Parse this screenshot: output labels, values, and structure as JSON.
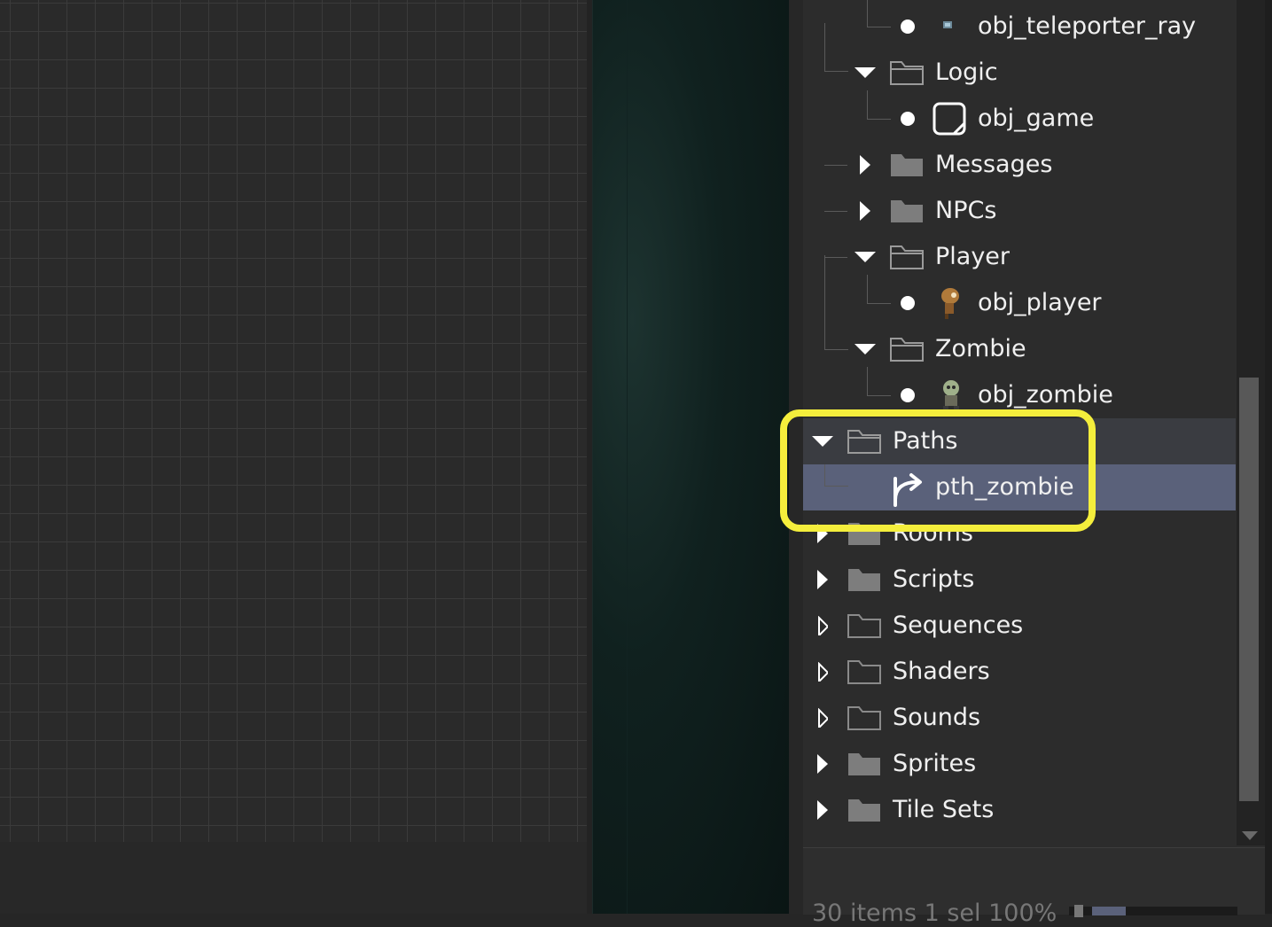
{
  "asset_browser": {
    "tree": [
      {
        "label": "obj_teleporter_ray",
        "type": "object",
        "icon": "teleporter-sprite-icon"
      },
      {
        "label": "Logic",
        "type": "folder",
        "expanded": true
      },
      {
        "label": "obj_game",
        "type": "object",
        "icon": "empty-sprite-icon"
      },
      {
        "label": "Messages",
        "type": "folder",
        "expanded": false
      },
      {
        "label": "NPCs",
        "type": "folder",
        "expanded": false
      },
      {
        "label": "Player",
        "type": "folder",
        "expanded": true
      },
      {
        "label": "obj_player",
        "type": "object",
        "icon": "player-sprite-icon"
      },
      {
        "label": "Zombie",
        "type": "folder",
        "expanded": true
      },
      {
        "label": "obj_zombie",
        "type": "object",
        "icon": "zombie-sprite-icon"
      },
      {
        "label": "Paths",
        "type": "folder",
        "expanded": true
      },
      {
        "label": "pth_zombie",
        "type": "path",
        "icon": "path-icon",
        "selected": true
      },
      {
        "label": "Rooms",
        "type": "folder",
        "expanded": false
      },
      {
        "label": "Scripts",
        "type": "folder",
        "expanded": false
      },
      {
        "label": "Sequences",
        "type": "folder",
        "expanded": false,
        "empty": true
      },
      {
        "label": "Shaders",
        "type": "folder",
        "expanded": false,
        "empty": true
      },
      {
        "label": "Sounds",
        "type": "folder",
        "expanded": false,
        "empty": true
      },
      {
        "label": "Sprites",
        "type": "folder",
        "expanded": false
      },
      {
        "label": "Tile Sets",
        "type": "folder",
        "expanded": false
      }
    ],
    "status": "30 items    1 sel  100%"
  },
  "colors": {
    "highlight": "#f4ee3c",
    "selection": "#5a617a",
    "hover": "#3a3c41"
  }
}
